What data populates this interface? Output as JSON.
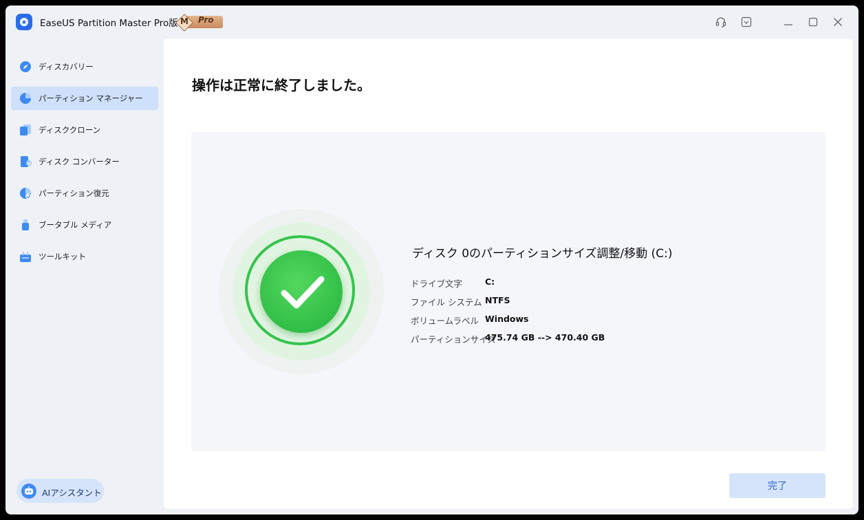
{
  "app": {
    "title": "EaseUS Partition Master Pro版",
    "badge_letter": "M",
    "badge_text": "Pro"
  },
  "sidebar": {
    "items": [
      {
        "label": "ディスカバリー",
        "icon": "compass-icon",
        "active": false
      },
      {
        "label": "パーティション マネージャー",
        "icon": "pie-chart-icon",
        "active": true
      },
      {
        "label": "ディスククローン",
        "icon": "disk-clone-icon",
        "active": false
      },
      {
        "label": "ディスク コンバーター",
        "icon": "disk-convert-icon",
        "active": false
      },
      {
        "label": "パーティション復元",
        "icon": "partition-recovery-icon",
        "active": false
      },
      {
        "label": "ブータブル メディア",
        "icon": "usb-icon",
        "active": false
      },
      {
        "label": "ツールキット",
        "icon": "toolbox-icon",
        "active": false
      }
    ],
    "ai_label": "AIアシスタント"
  },
  "main": {
    "title": "操作は正常に終了しました。",
    "operation": "ディスク 0のパーティションサイズ調整/移動 (C:)",
    "details": [
      {
        "label": "ドライブ文字",
        "value": "C:"
      },
      {
        "label": "ファイル システム",
        "value": "NTFS"
      },
      {
        "label": "ボリュームラベル",
        "value": "Windows"
      },
      {
        "label": "パーティションサイズ",
        "value": "475.74 GB --> 470.40 GB"
      }
    ],
    "done_label": "完了"
  },
  "colors": {
    "accent": "#2a62cc",
    "success": "#2dbb45",
    "active_nav": "#cfe0fb"
  }
}
